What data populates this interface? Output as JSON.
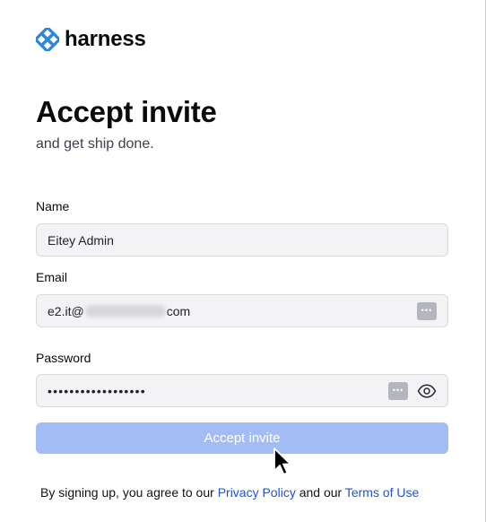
{
  "brand": {
    "name": "harness",
    "color": "#2a87e0"
  },
  "heading": {
    "title": "Accept invite",
    "subtitle": "and get ship done."
  },
  "form": {
    "name_label": "Name",
    "name_value": "Eitey Admin",
    "email_label": "Email",
    "email_prefix": "e2.it@",
    "email_suffix": "com",
    "password_label": "Password",
    "password_mask": "••••••••••••••••••",
    "submit_label": "Accept invite",
    "submit_color": "#a3bdf4"
  },
  "footer": {
    "prefix": "By signing up, you agree to our ",
    "privacy_link": "Privacy Policy",
    "middle": " and our ",
    "terms_link": "Terms of Use",
    "link_color": "#1d52d9"
  },
  "icons": {
    "logo": "harness-logo-icon",
    "password_manager": "password-manager-key-icon",
    "show_password": "eye-icon",
    "cursor": "mouse-pointer-icon"
  }
}
